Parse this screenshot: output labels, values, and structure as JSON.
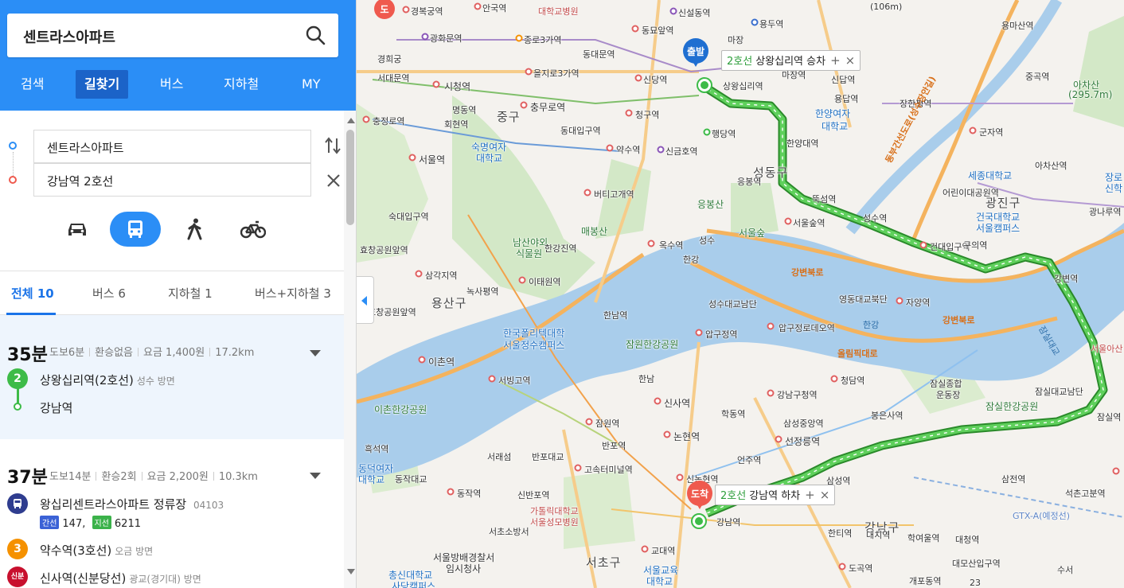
{
  "search": {
    "query": "센트라스아파트"
  },
  "nav_tabs": [
    {
      "label": "검색"
    },
    {
      "label": "길찾기"
    },
    {
      "label": "버스"
    },
    {
      "label": "지하철"
    },
    {
      "label": "MY"
    }
  ],
  "route": {
    "origin": "센트라스아파트",
    "destination": "강남역 2호선"
  },
  "modes": [
    "car-icon",
    "bus-icon",
    "walk-icon",
    "bicycle-icon"
  ],
  "result_tabs": [
    {
      "label": "전체 10"
    },
    {
      "label": "버스 6"
    },
    {
      "label": "지하철 1"
    },
    {
      "label": "버스+지하철 3"
    }
  ],
  "results": [
    {
      "time": "35분",
      "walk": "도보6분",
      "transfer": "환승없음",
      "fare": "요금 1,400원",
      "distance": "17.2km",
      "steps": [
        {
          "badge": "2",
          "name": "상왕십리역(2호선)",
          "direction": "성수 방면"
        },
        {
          "name": "강남역"
        }
      ]
    },
    {
      "time": "37분",
      "walk": "도보14분",
      "transfer": "환승2회",
      "fare": "요금 2,200원",
      "distance": "10.3km",
      "steps": [
        {
          "name": "왕십리센트라스아파트 정류장",
          "code": "04103",
          "bus_type_1": "간선",
          "bus_1": "147,",
          "bus_type_2": "지선",
          "bus_2": "6211"
        },
        {
          "badge": "3",
          "name": "약수역(3호선)",
          "direction": "오금 방면"
        },
        {
          "badge": "신분",
          "name": "신사역(신분당선)",
          "direction": "광교(경기대) 방면"
        }
      ]
    }
  ],
  "map": {
    "start_pin": "출발",
    "end_pin": "도착",
    "start_callout": {
      "line": "2호선",
      "text": "상왕십리역 승차"
    },
    "end_callout": {
      "line": "2호선",
      "text": "강남역 하차"
    },
    "callout_add": "+",
    "callout_close": "×",
    "corner_pin": "도",
    "labels": {
      "gyeongbokgung": "경복궁역",
      "anguk": "안국역",
      "snu_hospital": "대학교병원",
      "sinseol": "신설동역",
      "yongdu": "용두역",
      "yongmasan": "용마산역",
      "gwanghwamun": "광화문역",
      "jongno3": "종로3가역",
      "dongmyo": "동묘앞역",
      "majang": "마장",
      "gyeonghuigung": "경희궁",
      "seodaemun": "서대문역",
      "cityhall": "시청역",
      "euljiro3": "을지로3가역",
      "dongdaemunmun": "동대문역",
      "sindang": "신당역",
      "sinwangsimni": "상왕십리역",
      "majang2": "마장역",
      "myeongdong": "명동역",
      "chungmuro": "충무로역",
      "junggu": "중구",
      "cheonggu": "청구역",
      "hoehyeon": "회현역",
      "dongdaeipgu": "동대입구역",
      "yaksu": "약수역",
      "singeumho": "신금호역",
      "haengdang": "행당역",
      "hanyangdae": "한양대역",
      "chungjeongno": "충정로역",
      "seoulyeok": "서울역",
      "sookmyung": "숙명여자",
      "sookmyung2": "대학교",
      "beotigogae": "버티고개역",
      "eungbongsan": "응봉산",
      "eungbong": "응봉역",
      "seoulsup": "서울숲역",
      "seoulforest": "서울숲",
      "ttukseom": "뚝섬역",
      "seongsu": "성수역",
      "seongdonggu": "성동구",
      "sookdae": "숙대입구역",
      "namsan": "남산야외",
      "namsan2": "식물원",
      "maebongsan": "매봉산",
      "hangangjin": "한강진역",
      "oksu": "옥수역",
      "seongsu_jc": "성수",
      "konkuk": "건대입구역",
      "hyochang": "효창공원앞역",
      "samgakji": "삼각지역",
      "noksapyeong": "녹사평역",
      "itaewon": "이태원역",
      "yongsangu": "용산구",
      "hangangbridge": "한강",
      "yeongdong": "영동대교북단",
      "jayang": "자양역",
      "gangbyeon": "강변역",
      "seongsu_daegyo": "성수대교남단",
      "apgujeong_rodeo": "압구정로데오역",
      "hannam": "한남역",
      "apgujeong": "압구정역",
      "jamwon": "잠원한강공원",
      "cheongdam": "청담역",
      "hufs": "한국폴리텍대학",
      "hufs2": "서울정수캠퍼스",
      "ichon": "이촌역",
      "seobinggo": "서빙고역",
      "hannam2": "한남",
      "sinsa": "신사역",
      "gangnamgucheong": "강남구청역",
      "ichon_park": "이촌한강공원",
      "jamwon2": "잠원역",
      "hakdong": "학동역",
      "samseongjungang": "삼성중앙역",
      "bongeunsa": "봉은사역",
      "jamsil_sports": "잠실종합",
      "jamsil_sports2": "운동장",
      "jamsil_park": "잠실한강공원",
      "jamsildaegyo": "잠실대교남단",
      "jamsilnaru": "잠실역",
      "heukseok": "흑석역",
      "seoraeseom": "서래섬",
      "banpo": "반포역",
      "nonhyeon": "논현역",
      "seonjeongneung": "선정릉역",
      "gosokterminal": "고속터미널역",
      "banpo_jc": "반포대교",
      "eonju": "언주역",
      "dongjak": "동작역",
      "sinbanpo": "신반포역",
      "catholic": "가톨릭대학교",
      "catholic2": "서울성모병원",
      "sinnonhyeon": "신논현역",
      "samseong": "삼성역",
      "samjeon": "삼전역",
      "seokchon": "석촌고분역",
      "dongjak_bridge": "동작대교",
      "seochobangseo": "서초소방서",
      "gangnam_lbl": "강남역",
      "hanti": "한티역",
      "gangnamgu": "강남구",
      "daechi": "대치역",
      "hagyeoul": "학여울역",
      "daecheong": "대청역",
      "seoulbang": "서울방배경찰서",
      "imsicheongsa": "임시청사",
      "seochogu": "서초구",
      "gyodae": "교대역",
      "seoul_edu": "서울교육",
      "seoul_edu2": "대학교",
      "dogok": "도곡역",
      "gaepo": "개포동역",
      "daemo": "대모산입구역",
      "suseo": "수서",
      "gtx": "GTX-A(예정선)",
      "chongshin": "총신대학교",
      "sadang": "사당캠퍼스",
      "hanyang_univ": "한양여자",
      "hanyang_univ2": "대학교",
      "hanyang_st": "한양대역",
      "sejong": "세종대학교",
      "childpark": "어린이대공원역",
      "konkuk_univ": "건국대학교",
      "konkuk_univ2": "서울캠퍼스",
      "gwangjin": "광진구",
      "guui": "구의역",
      "achasan": "아차산",
      "achasan_h": "(295.7m)",
      "achasan_st": "아차산역",
      "gunja": "군자역",
      "janghanpyeong": "장한평역",
      "yongdap": "용답역",
      "gugok": "중곡역",
      "sinjeong": "신답역",
      "dongbu": "동부간선도로(성수장안길)",
      "gangbyeonbukro": "강변북로",
      "gangbyeonbukro2": "강변북로",
      "olympic": "올림픽대로",
      "hangang_r": "한강",
      "jamsil_r": "잠실대교",
      "seoul_asan": "서울아산",
      "jangro": "장로",
      "sinhak": "신학",
      "gwangnaru": "광나루역",
      "daehak": "대학교",
      "daehakbyeongwon": "대학교병원",
      "ewha": "동덕여자",
      "ewha2": "대학교",
      "hyochangpark": "효창공원앞역",
      "hanyang_yeodae": "한양여자",
      "ganghangongwon": "강남",
      "height_106": "(106m)",
      "road_23": "23"
    }
  },
  "colors": {
    "brand_blue": "#2b8ef6",
    "active_tab_bg": "#1b63c8",
    "route_green": "#3dbb48",
    "river": "#a9cdeb",
    "park": "#cfe5c2",
    "end_pin": "#ef5a4e",
    "start_pin": "#1f6fd1"
  }
}
